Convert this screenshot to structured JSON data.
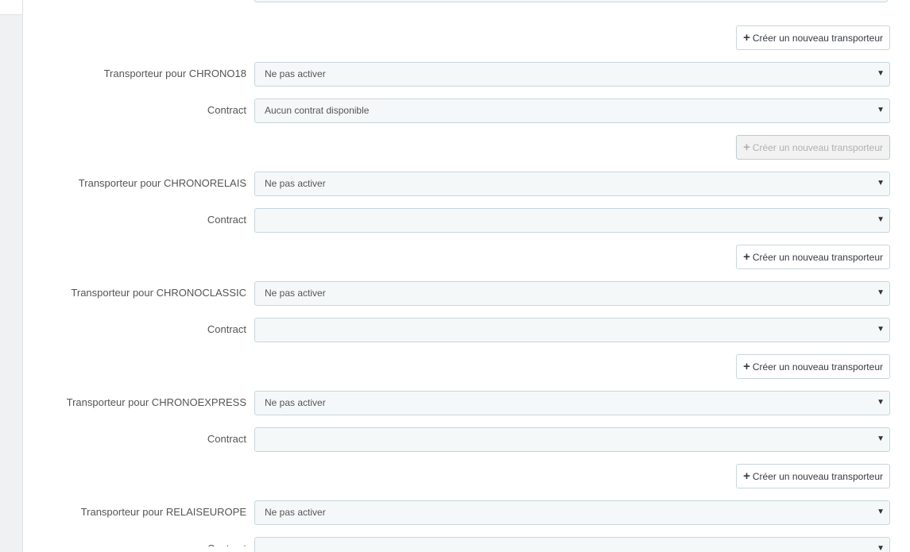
{
  "create_button_label": "Créer un nouveau transporteur",
  "arrow_glyph": "▼",
  "sections": [
    {
      "carrier_label": "Transporteur pour CHRONO18",
      "carrier_value": "Ne pas activer",
      "contract_label": "Contract",
      "contract_value": "Aucun contrat disponible",
      "button_disabled": false
    },
    {
      "carrier_label": "Transporteur pour CHRONORELAIS",
      "carrier_value": "Ne pas activer",
      "contract_label": "Contract",
      "contract_value": "",
      "button_disabled": true
    },
    {
      "carrier_label": "Transporteur pour CHRONOCLASSIC",
      "carrier_value": "Ne pas activer",
      "contract_label": "Contract",
      "contract_value": "",
      "button_disabled": false
    },
    {
      "carrier_label": "Transporteur pour CHRONOEXPRESS",
      "carrier_value": "Ne pas activer",
      "contract_label": "Contract",
      "contract_value": "",
      "button_disabled": false
    },
    {
      "carrier_label": "Transporteur pour RELAISEUROPE",
      "carrier_value": "Ne pas activer",
      "contract_label": "Contract",
      "contract_value": "",
      "button_disabled": false
    }
  ],
  "colors": {
    "page_background": "#eff1f2",
    "panel_background": "#ffffff",
    "select_background": "#f5f8f9",
    "border": "#c7d6db",
    "label_text": "#555555",
    "button_text": "#363a41",
    "disabled_text": "#b0b0b0"
  }
}
